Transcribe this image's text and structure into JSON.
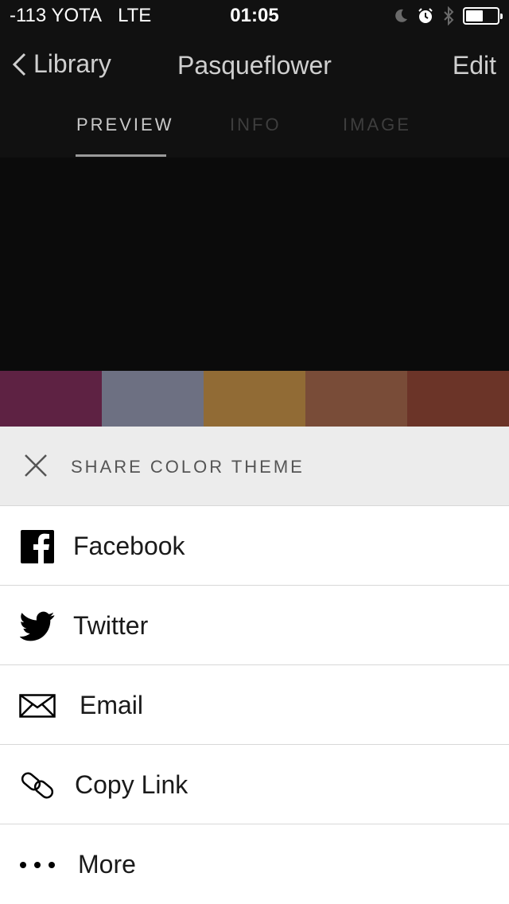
{
  "status_bar": {
    "carrier": "-113 YOTA",
    "network": "LTE",
    "time": "01:05"
  },
  "nav": {
    "back_label": "Library",
    "title": "Pasqueflower",
    "edit_label": "Edit"
  },
  "tabs": [
    {
      "label": "PREVIEW",
      "active": true
    },
    {
      "label": "INFO",
      "active": false
    },
    {
      "label": "IMAGE",
      "active": false
    }
  ],
  "swatches": [
    "#5e2243",
    "#6d7082",
    "#916b35",
    "#794c38",
    "#6b3428"
  ],
  "share": {
    "title": "SHARE COLOR THEME",
    "items": [
      {
        "label": "Facebook",
        "icon": "facebook-icon"
      },
      {
        "label": "Twitter",
        "icon": "twitter-icon"
      },
      {
        "label": "Email",
        "icon": "envelope-icon"
      },
      {
        "label": "Copy Link",
        "icon": "link-icon"
      },
      {
        "label": "More",
        "icon": "more-icon"
      }
    ]
  }
}
